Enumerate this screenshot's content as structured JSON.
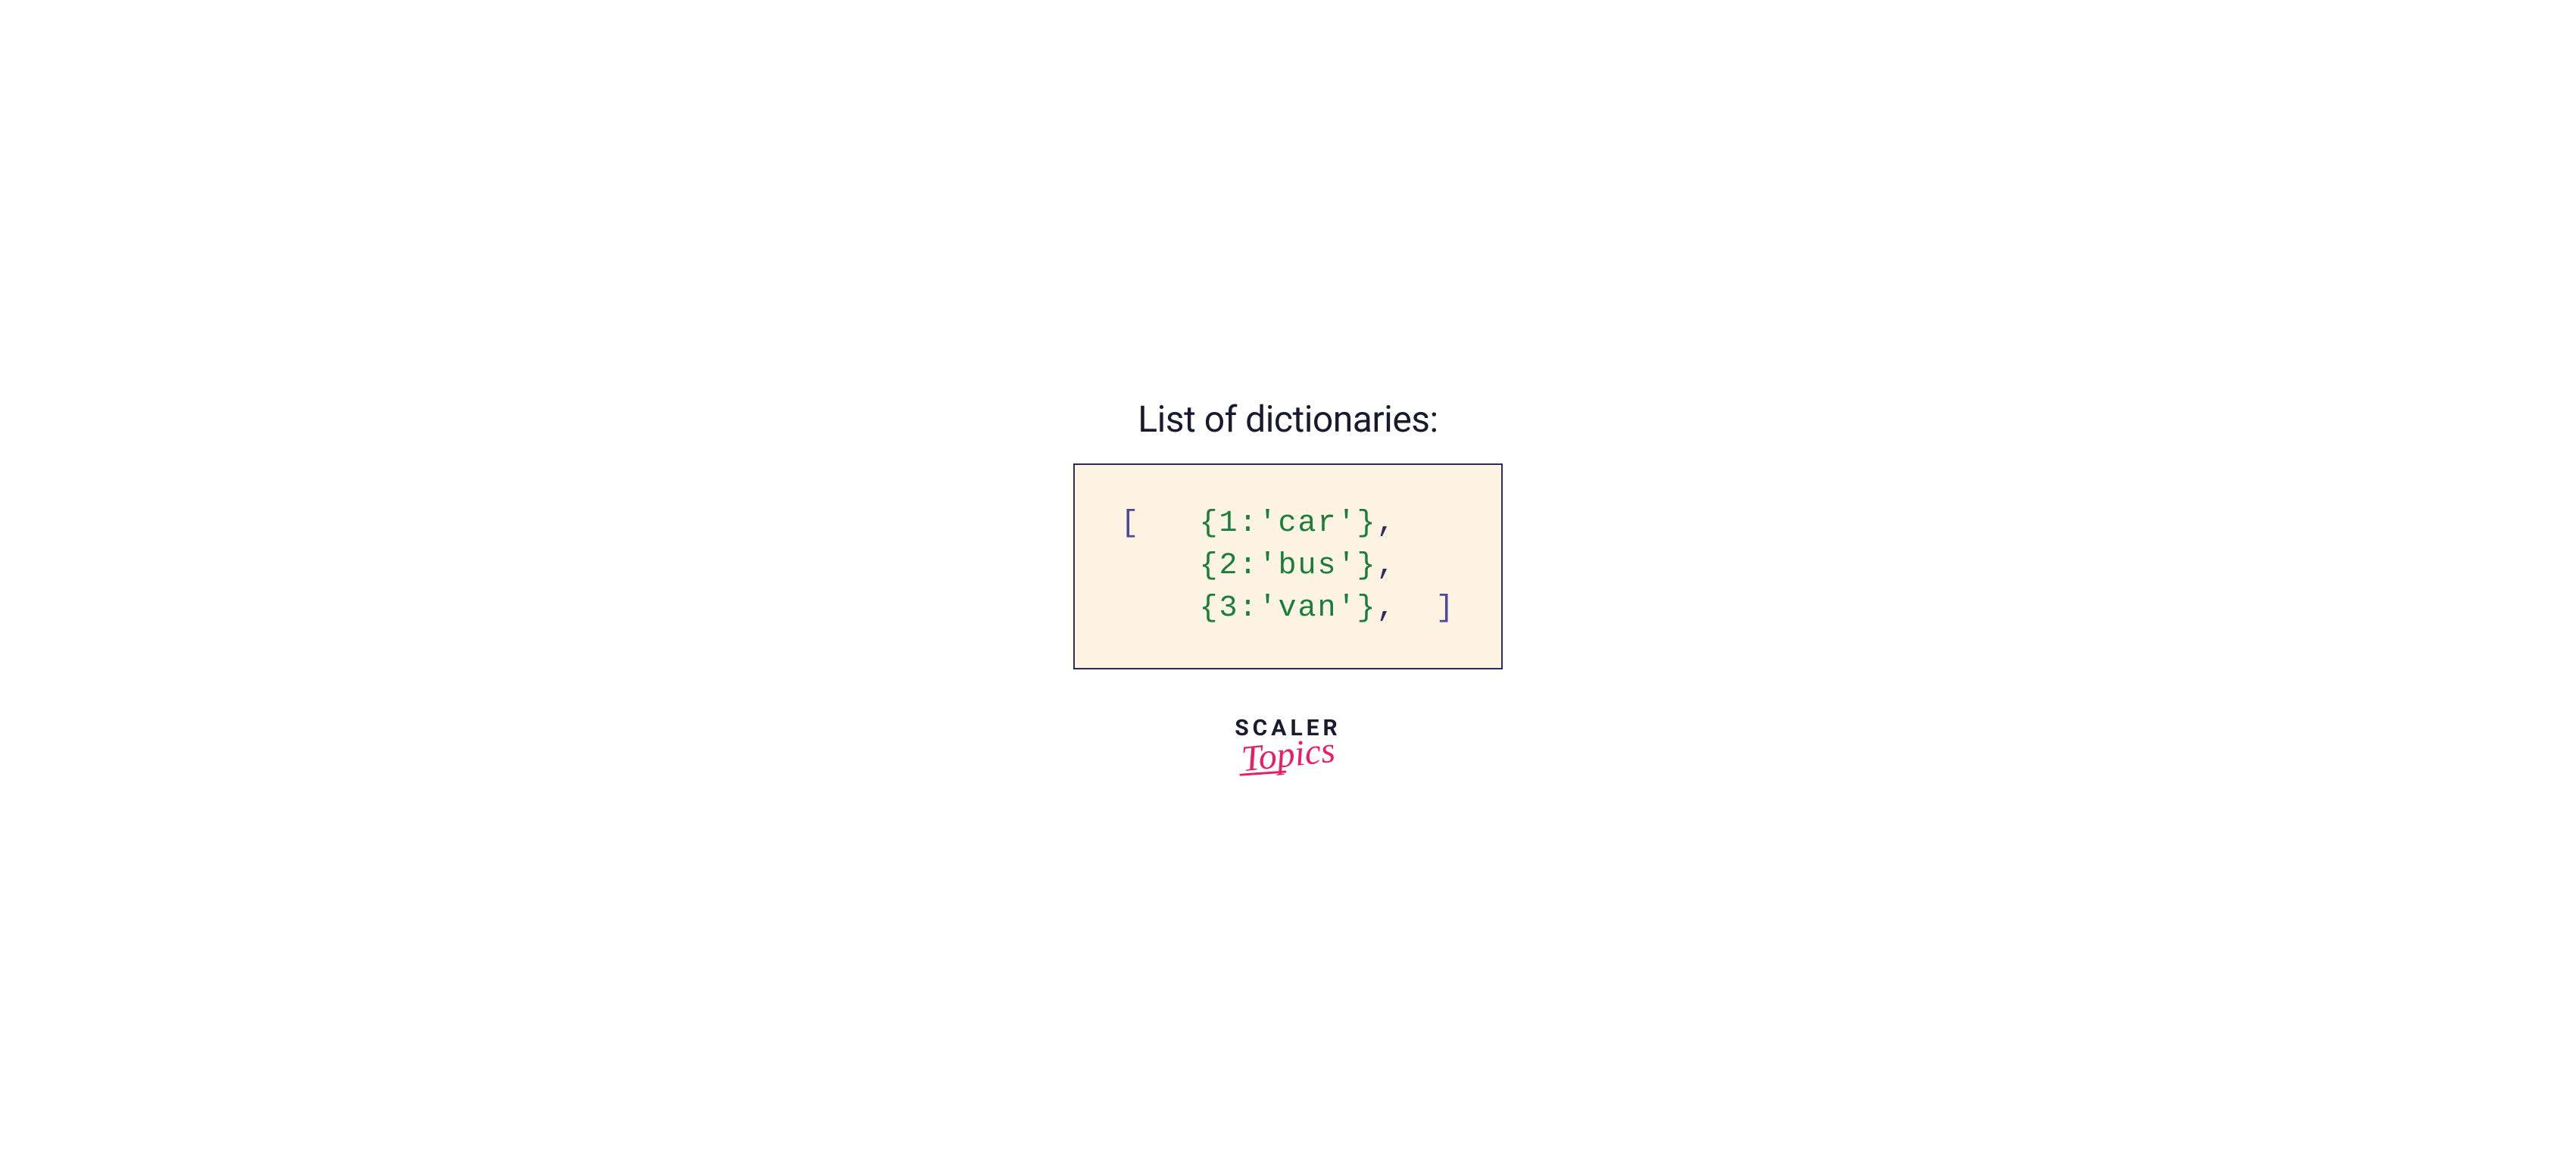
{
  "title": "List of dictionaries:",
  "code": {
    "open_bracket": "[",
    "close_bracket": "]",
    "line1": {
      "dict": "{1:'car'}",
      "comma": ","
    },
    "line2": {
      "dict": "{2:'bus'}",
      "comma": ","
    },
    "line3": {
      "dict": "{3:'van'}",
      "comma": ","
    }
  },
  "logo": {
    "top": "SCALER",
    "bottom": "Topics"
  },
  "colors": {
    "title": "#1a1a2e",
    "box_bg": "#fdf3e2",
    "box_border": "#2b2b5c",
    "bracket": "#4a4a9c",
    "dict": "#1a7d3b",
    "comma": "#2b2b5c",
    "logo_pink": "#e91e63"
  }
}
